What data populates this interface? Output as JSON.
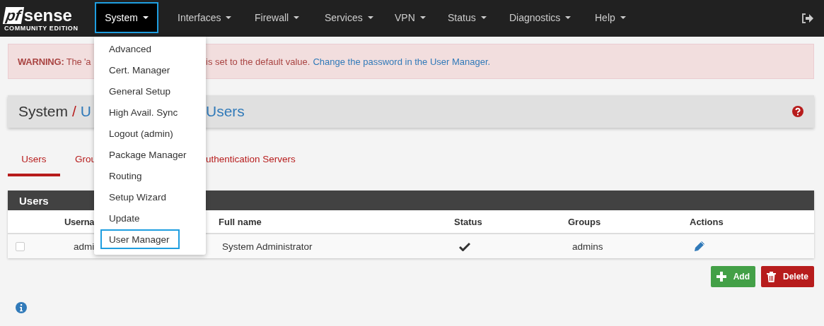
{
  "navbar": {
    "logo": {
      "mark": "pf",
      "name": "sense",
      "edition": "COMMUNITY EDITION"
    },
    "menus": [
      {
        "label": "System",
        "selected": true
      },
      {
        "label": "Interfaces",
        "selected": false
      },
      {
        "label": "Firewall",
        "selected": false
      },
      {
        "label": "Services",
        "selected": false
      },
      {
        "label": "VPN",
        "selected": false
      },
      {
        "label": "Status",
        "selected": false
      },
      {
        "label": "Diagnostics",
        "selected": false
      },
      {
        "label": "Help",
        "selected": false
      }
    ]
  },
  "dropdown": {
    "items": [
      {
        "label": "Advanced",
        "selected": false
      },
      {
        "label": "Cert. Manager",
        "selected": false
      },
      {
        "label": "General Setup",
        "selected": false
      },
      {
        "label": "High Avail. Sync",
        "selected": false
      },
      {
        "label": "Logout (admin)",
        "selected": false
      },
      {
        "label": "Package Manager",
        "selected": false
      },
      {
        "label": "Routing",
        "selected": false
      },
      {
        "label": "Setup Wizard",
        "selected": false
      },
      {
        "label": "Update",
        "selected": false
      },
      {
        "label": "User Manager",
        "selected": true
      }
    ]
  },
  "warning": {
    "label": "WARNING:",
    "text_before": "The 'a",
    "text_after": "is set to the default value.",
    "link": "Change the password in the User Manager."
  },
  "breadcrumb": {
    "root": "System",
    "separator": "/",
    "part_1": "U",
    "part_2": "Users"
  },
  "tabs": [
    {
      "label": "Users",
      "selected": true
    },
    {
      "label": "Grou",
      "selected": false
    },
    {
      "label": "uthentication Servers",
      "selected": false
    }
  ],
  "table": {
    "title": "Users",
    "columns": [
      "Userna",
      "Full name",
      "Status",
      "Groups",
      "Actions"
    ],
    "rows": [
      {
        "checked": false,
        "username": "admi",
        "full_name": "System Administrator",
        "enabled": true,
        "groups": "admins"
      }
    ]
  },
  "buttons": [
    {
      "kind": "add",
      "label": "Add"
    },
    {
      "kind": "delete",
      "label": "Delete"
    }
  ]
}
